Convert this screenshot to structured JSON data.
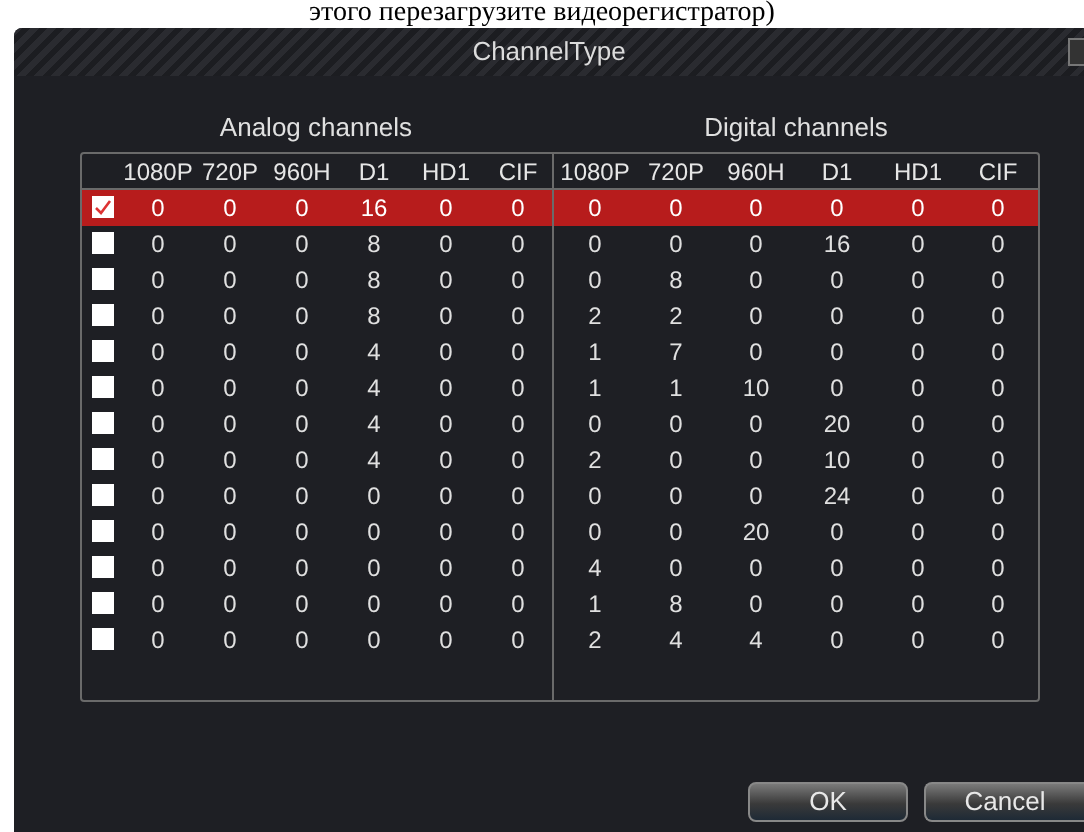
{
  "page_caption": "этого перезагрузите видеорегистратор)",
  "window": {
    "title": "ChannelType"
  },
  "groups": [
    "Analog channels",
    "Digital channels"
  ],
  "columns": {
    "analog": [
      "1080P",
      "720P",
      "960H",
      "D1",
      "HD1",
      "CIF"
    ],
    "digital": [
      "1080P",
      "720P",
      "960H",
      "D1",
      "HD1",
      "CIF"
    ]
  },
  "rows": [
    {
      "selected": true,
      "checked": true,
      "analog": [
        "0",
        "0",
        "0",
        "16",
        "0",
        "0"
      ],
      "digital": [
        "0",
        "0",
        "0",
        "0",
        "0",
        "0"
      ]
    },
    {
      "selected": false,
      "checked": false,
      "analog": [
        "0",
        "0",
        "0",
        "8",
        "0",
        "0"
      ],
      "digital": [
        "0",
        "0",
        "0",
        "16",
        "0",
        "0"
      ]
    },
    {
      "selected": false,
      "checked": false,
      "analog": [
        "0",
        "0",
        "0",
        "8",
        "0",
        "0"
      ],
      "digital": [
        "0",
        "8",
        "0",
        "0",
        "0",
        "0"
      ]
    },
    {
      "selected": false,
      "checked": false,
      "analog": [
        "0",
        "0",
        "0",
        "8",
        "0",
        "0"
      ],
      "digital": [
        "2",
        "2",
        "0",
        "0",
        "0",
        "0"
      ]
    },
    {
      "selected": false,
      "checked": false,
      "analog": [
        "0",
        "0",
        "0",
        "4",
        "0",
        "0"
      ],
      "digital": [
        "1",
        "7",
        "0",
        "0",
        "0",
        "0"
      ]
    },
    {
      "selected": false,
      "checked": false,
      "analog": [
        "0",
        "0",
        "0",
        "4",
        "0",
        "0"
      ],
      "digital": [
        "1",
        "1",
        "10",
        "0",
        "0",
        "0"
      ]
    },
    {
      "selected": false,
      "checked": false,
      "analog": [
        "0",
        "0",
        "0",
        "4",
        "0",
        "0"
      ],
      "digital": [
        "0",
        "0",
        "0",
        "20",
        "0",
        "0"
      ]
    },
    {
      "selected": false,
      "checked": false,
      "analog": [
        "0",
        "0",
        "0",
        "4",
        "0",
        "0"
      ],
      "digital": [
        "2",
        "0",
        "0",
        "10",
        "0",
        "0"
      ]
    },
    {
      "selected": false,
      "checked": false,
      "analog": [
        "0",
        "0",
        "0",
        "0",
        "0",
        "0"
      ],
      "digital": [
        "0",
        "0",
        "0",
        "24",
        "0",
        "0"
      ]
    },
    {
      "selected": false,
      "checked": false,
      "analog": [
        "0",
        "0",
        "0",
        "0",
        "0",
        "0"
      ],
      "digital": [
        "0",
        "0",
        "20",
        "0",
        "0",
        "0"
      ]
    },
    {
      "selected": false,
      "checked": false,
      "analog": [
        "0",
        "0",
        "0",
        "0",
        "0",
        "0"
      ],
      "digital": [
        "4",
        "0",
        "0",
        "0",
        "0",
        "0"
      ]
    },
    {
      "selected": false,
      "checked": false,
      "analog": [
        "0",
        "0",
        "0",
        "0",
        "0",
        "0"
      ],
      "digital": [
        "1",
        "8",
        "0",
        "0",
        "0",
        "0"
      ]
    },
    {
      "selected": false,
      "checked": false,
      "analog": [
        "0",
        "0",
        "0",
        "0",
        "0",
        "0"
      ],
      "digital": [
        "2",
        "4",
        "4",
        "0",
        "0",
        "0"
      ]
    }
  ],
  "buttons": [
    "OK",
    "Cancel"
  ]
}
